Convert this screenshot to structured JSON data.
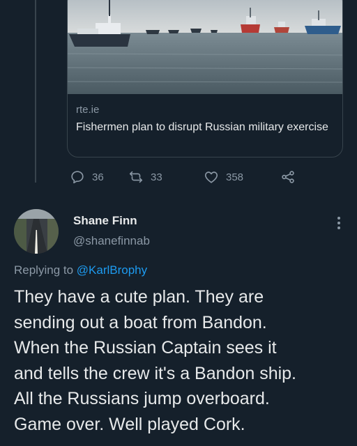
{
  "link_card": {
    "domain": "rte.ie",
    "title": "Fishermen plan to disrupt Russian military exercise",
    "image_alt": "fishing-boats-at-sea"
  },
  "actions": {
    "reply_count": "36",
    "retweet_count": "33",
    "like_count": "358"
  },
  "reply_tweet": {
    "display_name": "Shane Finn",
    "handle": "@shanefinnab",
    "replying_prefix": "Replying to ",
    "replying_to": "@KarlBrophy",
    "body_lines": [
      "They have a cute plan. They are",
      "sending out a boat from Bandon.",
      "When the Russian Captain sees it",
      "and tells the crew it's a Bandon ship.",
      "All the Russians jump overboard.",
      "Game over.  Well played Cork."
    ]
  },
  "colors": {
    "background": "#15202b",
    "text_primary": "#e7e9ea",
    "text_secondary": "#8b98a5",
    "link": "#1d9bf0",
    "border": "#38444d"
  },
  "icons": [
    "reply-icon",
    "retweet-icon",
    "like-icon",
    "share-icon",
    "more-icon"
  ]
}
